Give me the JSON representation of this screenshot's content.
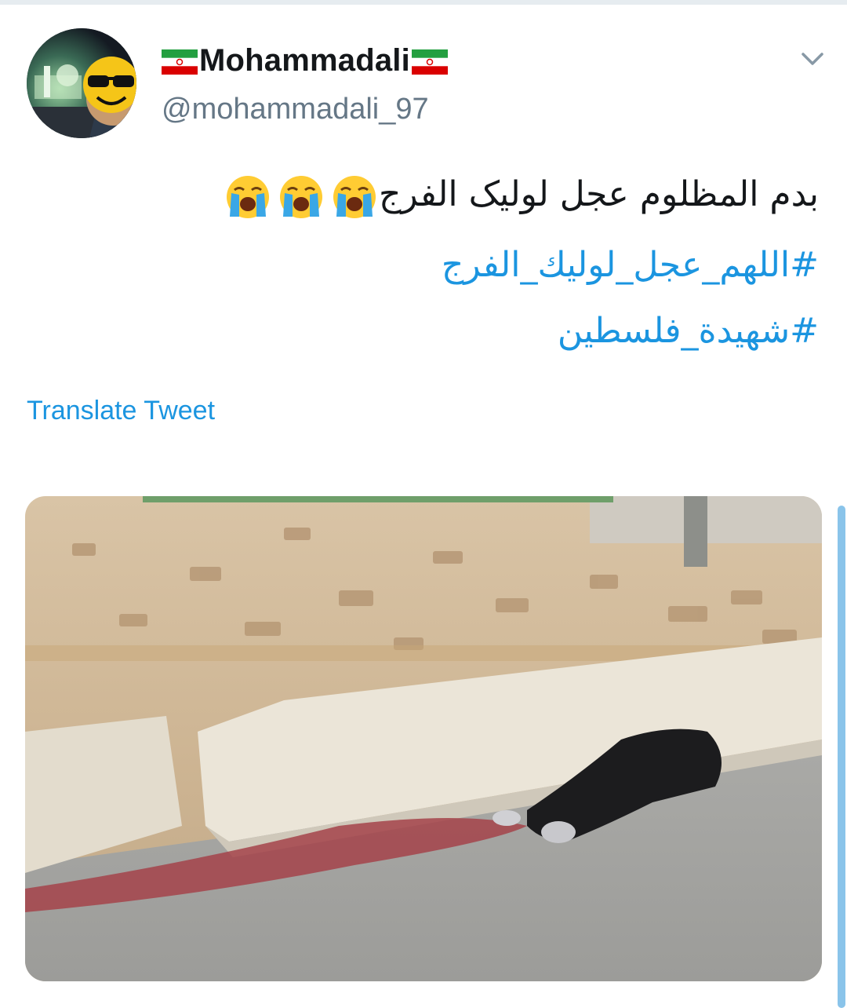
{
  "tweet": {
    "display_name": "Mohammadali",
    "handle": "@mohammadali_97",
    "text": "بدم المظلوم عجل لولیک الفرج",
    "emoji_count": 3,
    "emoji_name": "loudly-crying-face",
    "hashtags": [
      "#اللهم_عجل_لوليك_الفرج",
      "#شهيدة_فلسطين"
    ],
    "translate_label": "Translate Tweet",
    "flag_name": "iran-flag",
    "colors": {
      "link": "#1b95e0",
      "secondary_text": "#657786",
      "primary_text": "#14171a"
    }
  }
}
